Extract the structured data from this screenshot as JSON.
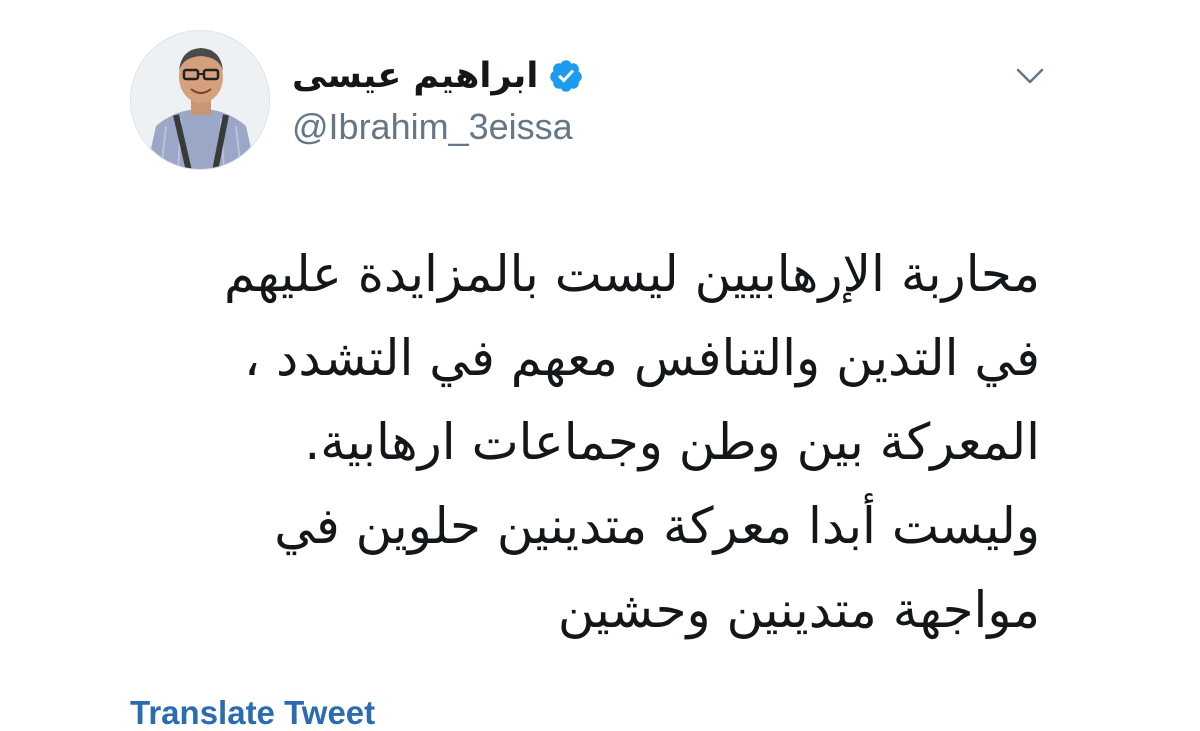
{
  "author": {
    "display_name": "ابراهيم عيسى",
    "handle": "@Ibrahim_3eissa",
    "verified": true,
    "avatar_icon": "person-with-glasses-and-suspenders"
  },
  "tweet": {
    "lines": [
      "محاربة الإرهابيين ليست بالمزايدة عليهم",
      "في التدين والتنافس معهم في التشدد ،",
      "المعركة بين وطن وجماعات ارهابية.",
      "وليست أبدا معركة متدينين حلوين في",
      "مواجهة متدينين وحشين"
    ]
  },
  "actions": {
    "translate_label": "Translate Tweet",
    "menu_icon": "chevron-down-icon"
  },
  "colors": {
    "text": "#14171a",
    "secondary_text": "#657786",
    "link": "#2b6cb0",
    "verified_badge": "#1d9bf0"
  }
}
